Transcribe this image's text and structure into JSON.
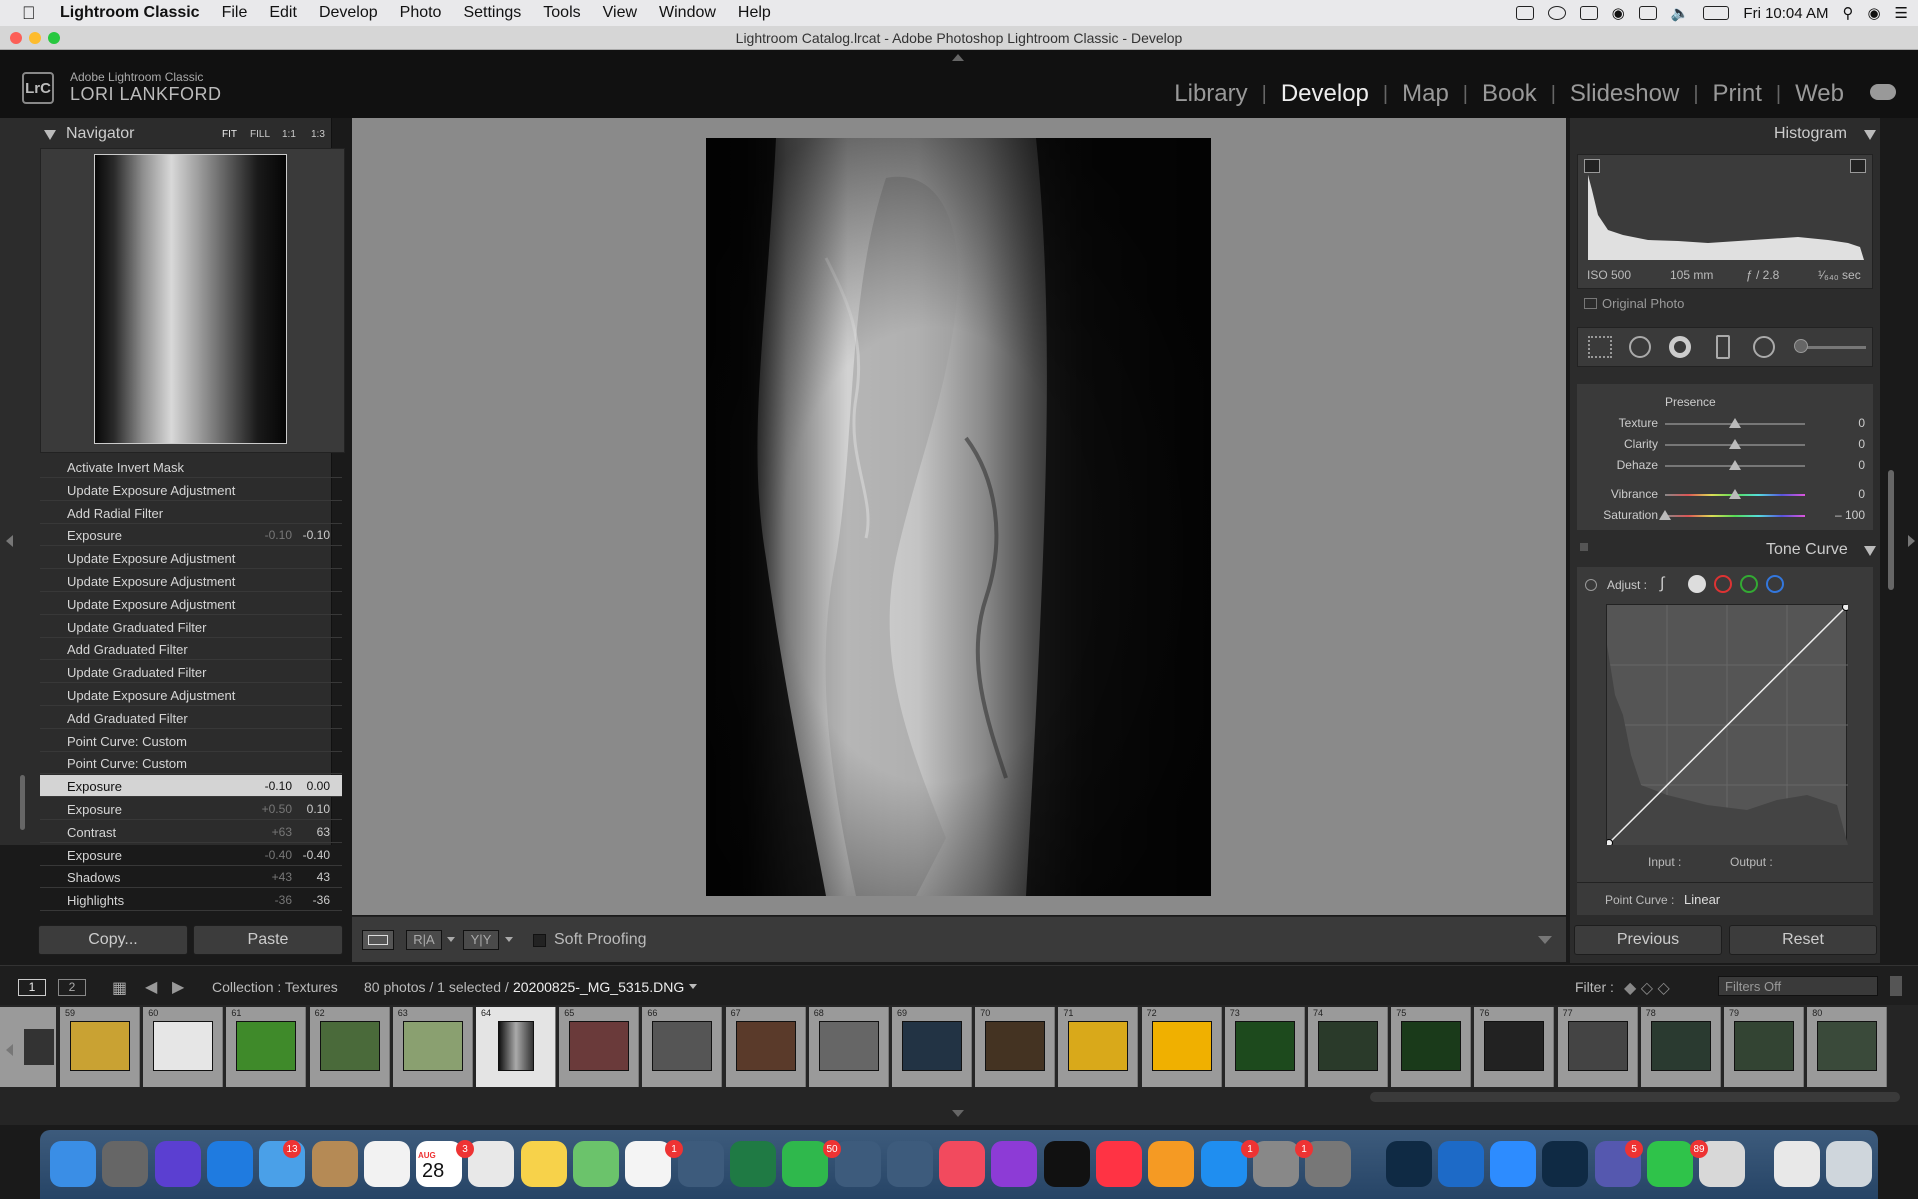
{
  "menubar": {
    "app": "Lightroom Classic",
    "menus": [
      "File",
      "Edit",
      "Develop",
      "Photo",
      "Settings",
      "Tools",
      "View",
      "Window",
      "Help"
    ],
    "clock": "Fri 10:04 AM"
  },
  "window": {
    "title": "Lightroom Catalog.lrcat - Adobe Photoshop Lightroom Classic - Develop"
  },
  "identity": {
    "badge": "LrC",
    "product": "Adobe Lightroom Classic",
    "user": "LORI LANKFORD"
  },
  "modules": [
    "Library",
    "Develop",
    "Map",
    "Book",
    "Slideshow",
    "Print",
    "Web"
  ],
  "navigator": {
    "title": "Navigator",
    "zoom": [
      "FIT",
      "FILL",
      "1:1",
      "1:3"
    ]
  },
  "history": [
    {
      "label": "Activate Invert Mask",
      "v1": "",
      "v2": ""
    },
    {
      "label": "Update Exposure Adjustment",
      "v1": "",
      "v2": ""
    },
    {
      "label": "Add Radial Filter",
      "v1": "",
      "v2": ""
    },
    {
      "label": "Exposure",
      "v1": "-0.10",
      "v2": "-0.10"
    },
    {
      "label": "Update Exposure Adjustment",
      "v1": "",
      "v2": ""
    },
    {
      "label": "Update Exposure Adjustment",
      "v1": "",
      "v2": ""
    },
    {
      "label": "Update Exposure Adjustment",
      "v1": "",
      "v2": ""
    },
    {
      "label": "Update Graduated Filter",
      "v1": "",
      "v2": ""
    },
    {
      "label": "Add Graduated Filter",
      "v1": "",
      "v2": ""
    },
    {
      "label": "Update Graduated Filter",
      "v1": "",
      "v2": ""
    },
    {
      "label": "Update Exposure Adjustment",
      "v1": "",
      "v2": ""
    },
    {
      "label": "Add Graduated Filter",
      "v1": "",
      "v2": ""
    },
    {
      "label": "Point Curve: Custom",
      "v1": "",
      "v2": ""
    },
    {
      "label": "Point Curve: Custom",
      "v1": "",
      "v2": ""
    },
    {
      "label": "Exposure",
      "v1": "-0.10",
      "v2": "0.00"
    },
    {
      "label": "Exposure",
      "v1": "+0.50",
      "v2": "0.10"
    },
    {
      "label": "Contrast",
      "v1": "+63",
      "v2": "63"
    },
    {
      "label": "Exposure",
      "v1": "-0.40",
      "v2": "-0.40"
    },
    {
      "label": "Shadows",
      "v1": "+43",
      "v2": "43"
    },
    {
      "label": "Highlights",
      "v1": "-36",
      "v2": "-36"
    }
  ],
  "left_buttons": {
    "copy": "Copy...",
    "paste": "Paste"
  },
  "toolbar": {
    "soft_proofing": "Soft Proofing"
  },
  "histogram": {
    "title": "Histogram",
    "iso": "ISO 500",
    "focal": "105 mm",
    "aperture": "ƒ / 2.8",
    "shutter": "¹⁄₆₄₀ sec",
    "original_photo": "Original Photo"
  },
  "presence": {
    "title": "Presence",
    "sliders": [
      {
        "label": "Texture",
        "value": "0",
        "pos": 0.5
      },
      {
        "label": "Clarity",
        "value": "0",
        "pos": 0.5
      },
      {
        "label": "Dehaze",
        "value": "0",
        "pos": 0.5
      },
      {
        "label": "Vibrance",
        "value": "0",
        "pos": 0.5
      },
      {
        "label": "Saturation",
        "value": "– 100",
        "pos": 0.0
      }
    ]
  },
  "tone_curve": {
    "title": "Tone Curve",
    "adjust": "Adjust :",
    "input": "Input :",
    "output": "Output :",
    "point_curve_label": "Point Curve :",
    "point_curve_value": "Linear"
  },
  "right_buttons": {
    "previous": "Previous",
    "reset": "Reset"
  },
  "filmbar": {
    "page1": "1",
    "page2": "2",
    "collection": "Collection : Textures",
    "status": "80 photos / 1 selected /",
    "filename": "20200825-_MG_5315.DNG",
    "filter_label": "Filter :",
    "filter_value": "Filters Off"
  },
  "filmstrip": {
    "numbers": [
      "59",
      "60",
      "61",
      "62",
      "63",
      "64",
      "65",
      "66",
      "67",
      "68",
      "69",
      "70",
      "71",
      "72",
      "73",
      "74",
      "75",
      "76",
      "77",
      "78",
      "79",
      "80"
    ],
    "selected": "64"
  },
  "dock_badges": [
    "13",
    "3",
    "1",
    "50",
    "1",
    "1",
    "5",
    "89"
  ],
  "dock_date": {
    "month": "AUG",
    "day": "28"
  }
}
